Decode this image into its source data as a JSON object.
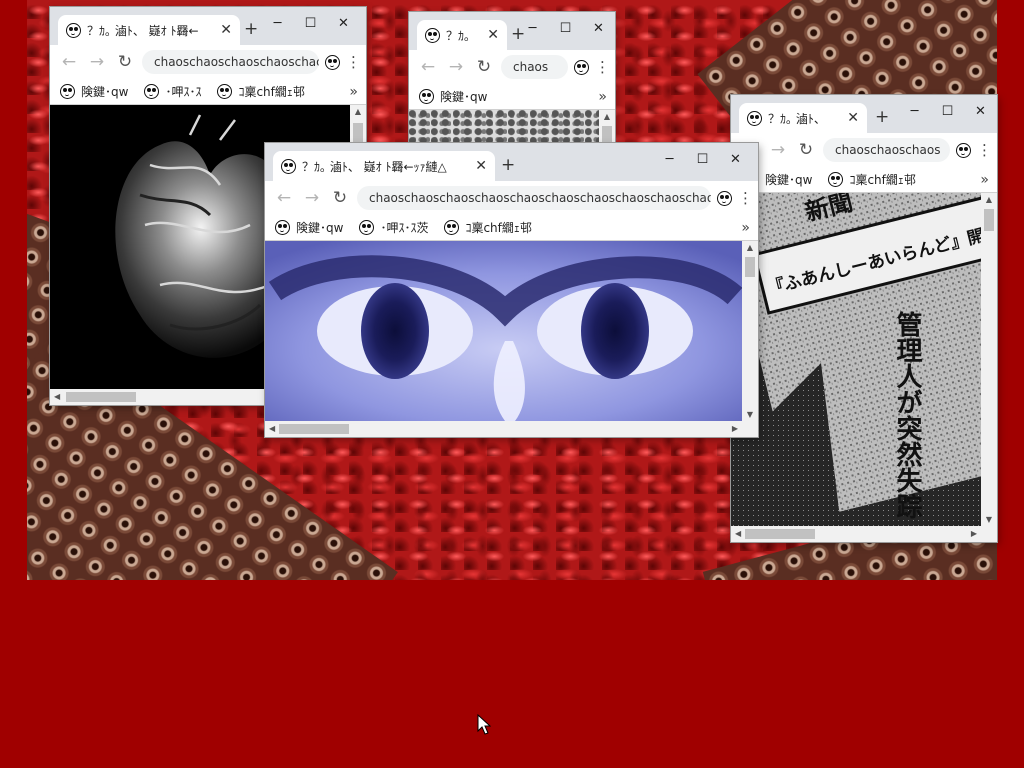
{
  "windows": [
    {
      "tab_title": "？ｶ｡ 滷ﾄ、 嶷ｵ ﾄ羇←",
      "address": "chaoschaoschaoschaoschao",
      "bookmarks": [
        "険鍵･qw",
        "･呷ｽ･ｽ",
        "ｺ稟chf繝ｪ邨"
      ],
      "content": "chrome-heart"
    },
    {
      "tab_title": "？ｶ｡",
      "address": "chaos",
      "bookmarks": [
        "険鍵･qw"
      ],
      "content": "grey-noise"
    },
    {
      "tab_title": "？ｶ｡ 滷ﾄ、 嶷ｵ ﾄ羇←ｯｧ縺△",
      "address": "chaoschaoschaoschaoschaoschaoschaoschaoschaoschaos",
      "bookmarks": [
        "険鍵･qw",
        "･呷ｽ･ｽ茨",
        "ｺ稟chf繝ｪ邨"
      ],
      "content": "blue-eyes"
    },
    {
      "tab_title": "？ｶ｡ 滷ﾄ、",
      "address": "chaoschaoschaos",
      "bookmarks": [
        "険鍵･qw",
        "ｺ稟chf繝ｪ邨"
      ],
      "content": "newspaper"
    }
  ],
  "newspaper": {
    "masthead": "新聞",
    "headline": "『ふあんしーあいらんど』開園",
    "subhead": "管理人が突然失踪"
  },
  "icons": {
    "tab_favicon": "smiley-face-icon",
    "tab_close": "close-icon",
    "new_tab": "plus-icon",
    "back": "arrow-left-icon",
    "forward": "arrow-right-icon",
    "reload": "reload-icon",
    "profile": "smiley-face-icon",
    "menu": "kebab-menu-icon",
    "overflow": "chevron-double-right-icon",
    "minimize": "minimize-icon",
    "maximize": "maximize-icon",
    "close_window": "close-icon"
  },
  "colors": {
    "desktop": "#a00000",
    "backdrop": "#b01818",
    "chrome_tabbar": "#dee1e6",
    "eyes_tint": "#8088d8"
  }
}
